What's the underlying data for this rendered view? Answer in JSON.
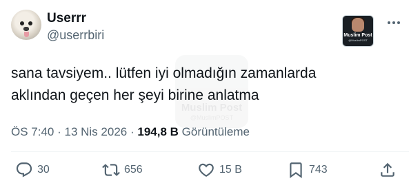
{
  "author": {
    "display_name": "Userrr",
    "handle": "@userrbiri",
    "avatar_icon": "dog-avatar"
  },
  "badge": {
    "title": "Muslim Post",
    "subtitle": "@MuslimPOST"
  },
  "watermark": {
    "title": "Muslim Post",
    "subtitle": "@MuslimPOST"
  },
  "tweet": {
    "line1": "sana tavsiyem.. lütfen iyi olmadığın zamanlarda",
    "line2": "aklından geçen her şeyi birine anlatma"
  },
  "meta": {
    "time": "ÖS 7:40",
    "separator": "·",
    "date": "13 Nis 2026",
    "views_count": "194,8 B",
    "views_label": "Görüntüleme"
  },
  "actions": {
    "reply": {
      "icon": "reply-icon",
      "count": "30"
    },
    "retweet": {
      "icon": "retweet-icon",
      "count": "656"
    },
    "like": {
      "icon": "heart-icon",
      "count": "15 B"
    },
    "bookmark": {
      "icon": "bookmark-icon",
      "count": "743"
    },
    "share": {
      "icon": "share-icon"
    }
  },
  "colors": {
    "text_primary": "#0f1419",
    "text_secondary": "#536471",
    "divider": "#eff3f4"
  }
}
